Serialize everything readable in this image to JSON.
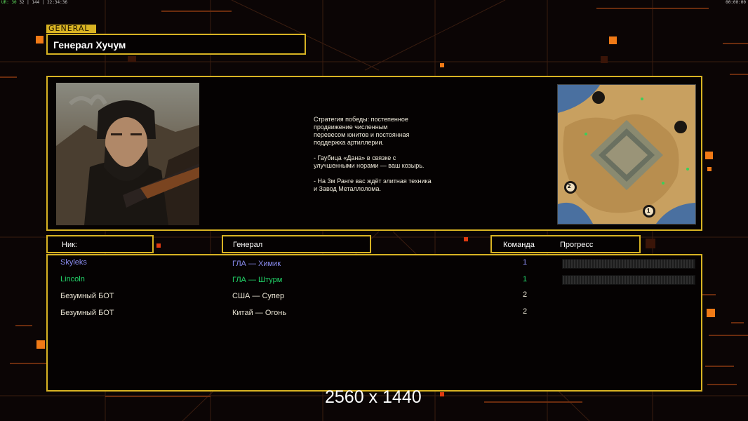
{
  "status_bar": {
    "left_prefix": "UR: 30",
    "left_counts": "32 | 144 |",
    "clock": "22:34:36",
    "right": "00:00:00"
  },
  "general_tag": "GENERAL",
  "general_title": "Генерал Хучум",
  "description": "Стратегия победы: постепенное\nпродвижение численным\nперевесом юнитов и постоянная\nподдержка артиллерии.\n\n- Гаубица «Дана» в связке с\nулучшенными норами — ваш козырь.\n\n- На 3м Ранге вас ждёт элитная техника\nи Завод Металлолома.",
  "columns": {
    "nick": "Ник:",
    "general": "Генерал",
    "team": "Команда",
    "progress": "Прогресс"
  },
  "players": [
    {
      "nick": "Skyleks",
      "general": "ГЛА — Химик",
      "team": "1",
      "color": "#8a8cf0",
      "progress": 0
    },
    {
      "nick": "Lincoln",
      "general": "ГЛА — Штурм",
      "team": "1",
      "color": "#22d66a",
      "progress": 0
    },
    {
      "nick": "Безумный БОТ",
      "general": "США — Супер",
      "team": "2",
      "color": "#e8e2d2",
      "progress": null
    },
    {
      "nick": "Безумный БОТ",
      "general": "Китай — Огонь",
      "team": "2",
      "color": "#e8e2d2",
      "progress": null
    }
  ],
  "map_markers": [
    "1",
    "2"
  ],
  "resolution_label": "2560 x 1440",
  "colors": {
    "frame": "#d8b323",
    "accent": "#f07a16",
    "background": "#0b0505"
  }
}
